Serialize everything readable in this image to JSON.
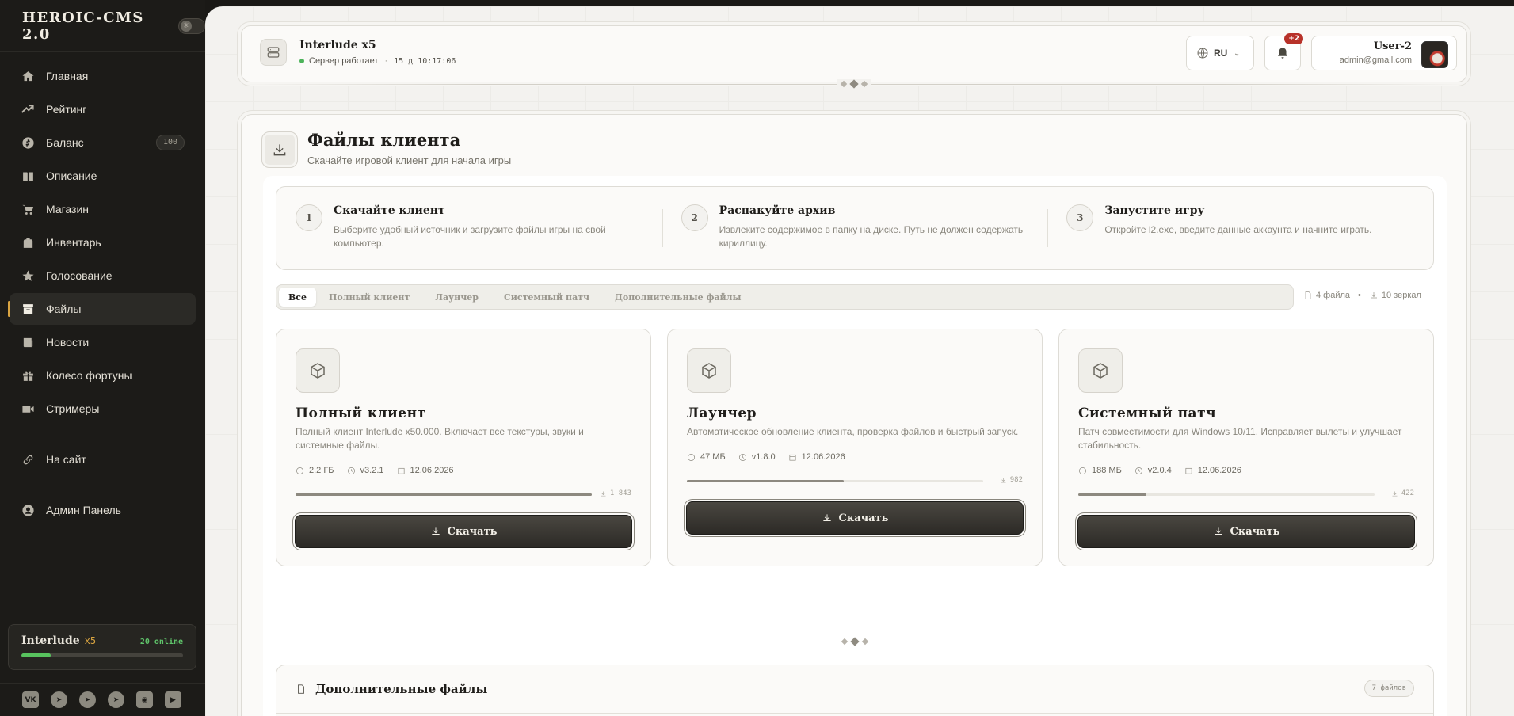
{
  "sidebar": {
    "brand": "HEROIC-CMS 2.0",
    "theme_toggle_glyph": "☼",
    "items": [
      {
        "label": "Главная",
        "icon": "home-icon"
      },
      {
        "label": "Рейтинг",
        "icon": "trending-icon"
      },
      {
        "label": "Баланс",
        "icon": "coin-icon",
        "badge": "100"
      },
      {
        "label": "Описание",
        "icon": "book-icon"
      },
      {
        "label": "Магазин",
        "icon": "cart-icon"
      },
      {
        "label": "Инвентарь",
        "icon": "backpack-icon"
      },
      {
        "label": "Голосование",
        "icon": "star-icon"
      },
      {
        "label": "Файлы",
        "icon": "archive-icon",
        "active": true
      },
      {
        "label": "Новости",
        "icon": "news-icon"
      },
      {
        "label": "Колесо фортуны",
        "icon": "gift-icon"
      },
      {
        "label": "Стримеры",
        "icon": "video-icon"
      }
    ],
    "site_link": "На сайт",
    "admin_link": "Админ Панель",
    "server_card": {
      "name": "Interlude",
      "rate": "x5",
      "online": "20 online",
      "online_fraction": 0.18
    },
    "socials": [
      "vk",
      "telegram",
      "telegram",
      "telegram",
      "discord",
      "youtube"
    ]
  },
  "topbar": {
    "server_name": "Interlude x5",
    "status": "Сервер работает",
    "uptime": "15 д 10:17:06",
    "lang": "RU",
    "notifications": "+2",
    "user_name": "User-2",
    "user_email": "admin@gmail.com"
  },
  "page": {
    "title": "Файлы клиента",
    "subtitle": "Скачайте игровой клиент для начала игры"
  },
  "steps": [
    {
      "num": "1",
      "title": "Скачайте клиент",
      "desc": "Выберите удобный источник и загрузите файлы игры на свой компьютер."
    },
    {
      "num": "2",
      "title": "Распакуйте архив",
      "desc": "Извлеките содержимое в папку на диске. Путь не должен содержать кириллицу."
    },
    {
      "num": "3",
      "title": "Запустите игру",
      "desc": "Откройте l2.exe, введите данные аккаунта и начните играть."
    }
  ],
  "tabs": [
    "Все",
    "Полный клиент",
    "Лаунчер",
    "Системный патч",
    "Дополнительные файлы"
  ],
  "stats": {
    "files": "4 файла",
    "mirrors": "10 зеркал"
  },
  "cards": [
    {
      "title": "Полный клиент",
      "desc": "Полный клиент Interlude x50.000. Включает все текстуры, звуки и системные файлы.",
      "size": "2.2 ГБ",
      "version": "v3.2.1",
      "date": "12.06.2026",
      "downloads": "1 843",
      "progress": 1.0,
      "button": "Скачать"
    },
    {
      "title": "Лаунчер",
      "desc": "Автоматическое обновление клиента, проверка файлов и быстрый запуск.",
      "size": "47 МБ",
      "version": "v1.8.0",
      "date": "12.06.2026",
      "downloads": "982",
      "progress": 0.53,
      "button": "Скачать"
    },
    {
      "title": "Системный патч",
      "desc": "Патч совместимости для Windows 10/11. Исправляет вылеты и улучшает стабильность.",
      "size": "188 МБ",
      "version": "v2.0.4",
      "date": "12.06.2026",
      "downloads": "422",
      "progress": 0.23,
      "button": "Скачать"
    }
  ],
  "extra": {
    "title": "Дополнительные файлы",
    "count": "7 файлов"
  }
}
